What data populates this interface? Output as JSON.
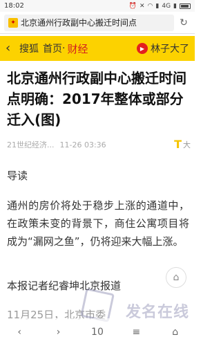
{
  "status_bar": {
    "time": "18:02",
    "network": "4G"
  },
  "url_bar": {
    "text": "北京通州行政副中心搬迁时间点"
  },
  "sohu_nav": {
    "back": "搜狐",
    "home": "首页",
    "separator": "·",
    "channel": "财经",
    "author": "林子大了",
    "accent_color": "#fcd200",
    "channel_color": "#d31f1f"
  },
  "article": {
    "title": "北京通州行政副中心搬迁时间点明确：2017年整体或部分迁入(图)",
    "source": "21世纪经济...",
    "date": "11-26 03:36",
    "font_size_icon": "T",
    "font_size_label": "大",
    "lead_label": "导读",
    "lead_text": "通州的房价将处于稳步上涨的通道中，在政策未变的背景下，商住公寓项目将成为“漏网之鱼”，仍将迎来大幅上涨。",
    "reporter": "本报记者纪睿坤北京报道",
    "body_start": "11月25日，北京市委"
  },
  "watermark": {
    "text": "发名在线"
  },
  "toolbar": {
    "page": "10"
  }
}
